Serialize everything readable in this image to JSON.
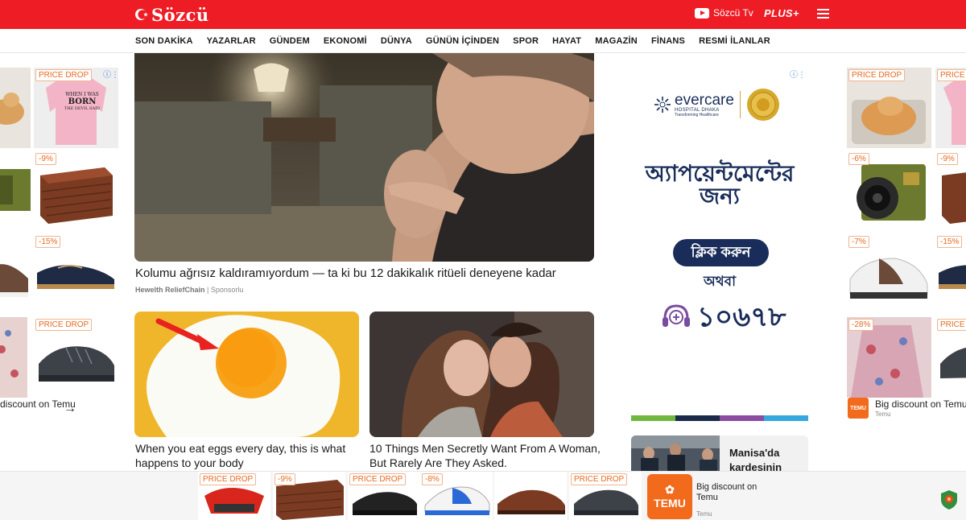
{
  "header": {
    "logo_text": "Sözcü",
    "tv_label": "Sözcü Tv",
    "plus_label": "PLUS+",
    "colors": {
      "brand": "#ee1c25"
    }
  },
  "nav": {
    "items": [
      "SON DAKİKA",
      "YAZARLAR",
      "GÜNDEM",
      "EKONOMİ",
      "DÜNYA",
      "GÜNÜN İÇİNDEN",
      "SPOR",
      "HAYAT",
      "MAGAZİN",
      "FİNANS",
      "RESMİ İLANLAR"
    ]
  },
  "left_rail": {
    "tags": [
      "PRICE DROP",
      "-9%",
      "-15%",
      "PRICE DROP"
    ],
    "tile_texts": [
      "WHEN I WAS",
      "BORN",
      "THE DEVIL SAID"
    ],
    "footer": "discount on Temu",
    "arrow": "→"
  },
  "right_rail": {
    "tags_a": [
      "PRICE DROP",
      "-6%",
      "-7%",
      "-28%"
    ],
    "tags_b": [
      "PRICE",
      "-9%",
      "-15%",
      "PRICE"
    ],
    "footer_title": "Big discount on Temu",
    "footer_sub": "Temu"
  },
  "main": {
    "hero_title": "Kolumu ağrısız kaldıramıyordum — ta ki bu 12 dakikalık ritüeli deneyene kadar",
    "hero_sponsor_name": "Hewelth ReliefChain",
    "hero_sponsor_label": "Sponsorlu",
    "cards": [
      {
        "title": "When you eat eggs every day, this is what happens to your body"
      },
      {
        "title": "10 Things Men Secretly Want From A Woman, But Rarely Are They Asked."
      }
    ]
  },
  "ad": {
    "brand": "evercare",
    "brand_sub": "HOSPITAL DHAKA",
    "brand_tag": "Transforming Healthcare",
    "headline": "অ্যাপয়েন্টমেন্টের জন্য",
    "cta": "ক্লিক করুন",
    "or": "অথবা",
    "phone": "১০৬৭৮"
  },
  "stripe_colors": [
    "#6fb73f",
    "#1c2a4a",
    "#8a4ca0",
    "#35a8dd"
  ],
  "news": {
    "title_line1": "Manisa'da",
    "title_line2": "kardeşinin"
  },
  "sticky": {
    "tags": [
      "PRICE DROP",
      "-9%",
      "PRICE DROP",
      "-8%",
      "",
      "PRICE DROP"
    ],
    "temu_label": "TEMU",
    "title": "Big discount on Temu",
    "sub": "Temu"
  }
}
